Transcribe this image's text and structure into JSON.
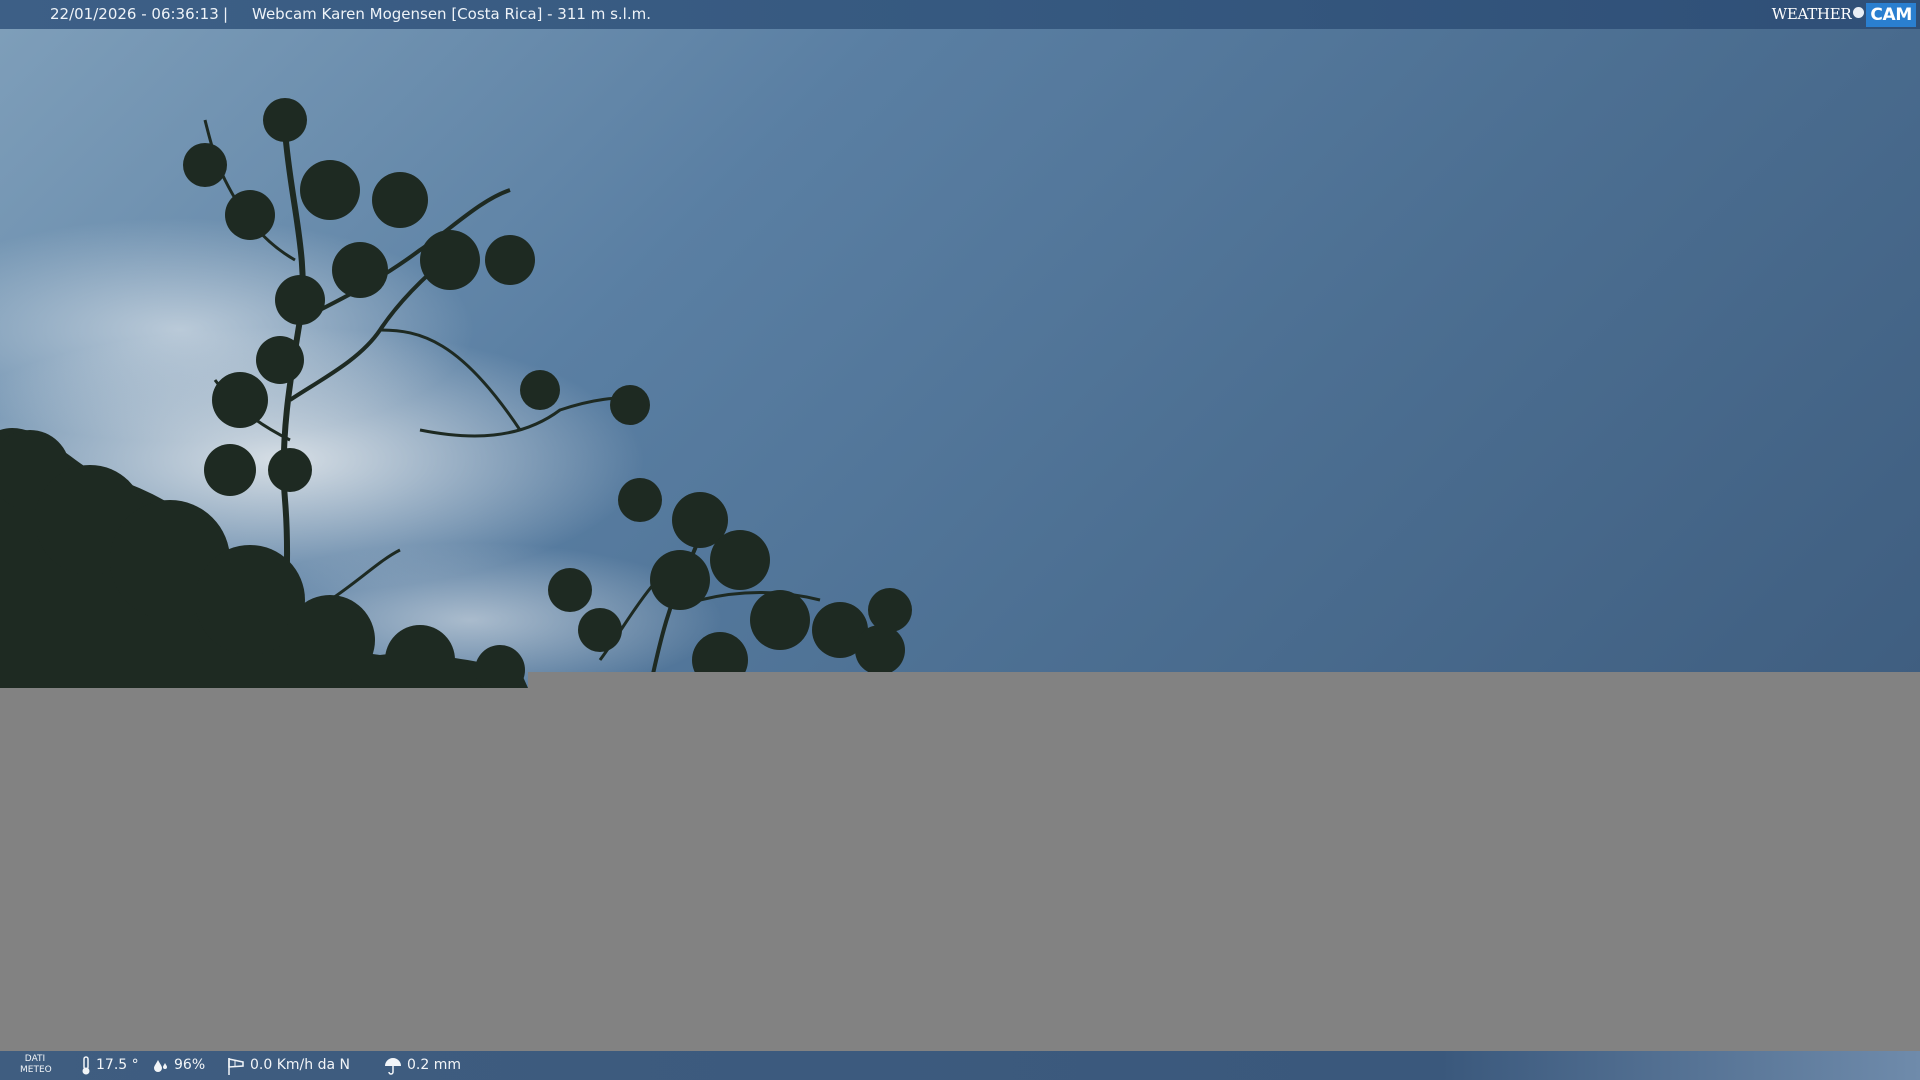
{
  "topbar": {
    "datetime": "22/01/2026 - 06:36:13",
    "separator": "|",
    "title": "Webcam Karen Mogensen [Costa Rica]  - 311 m s.l.m."
  },
  "logo": {
    "weather": "WEATHER",
    "cam": "CAM"
  },
  "weather_bar": {
    "label_line1": "DATI",
    "label_line2": "METEO",
    "temperature": "17.5 °",
    "humidity": "96%",
    "wind": "0.0 Km/h da N",
    "rain": "0.2 mm"
  },
  "icons": {
    "temperature": "thermometer-icon",
    "humidity": "humidity-drops-icon",
    "wind": "wind-sock-icon",
    "rain": "rain-umbrella-icon"
  }
}
